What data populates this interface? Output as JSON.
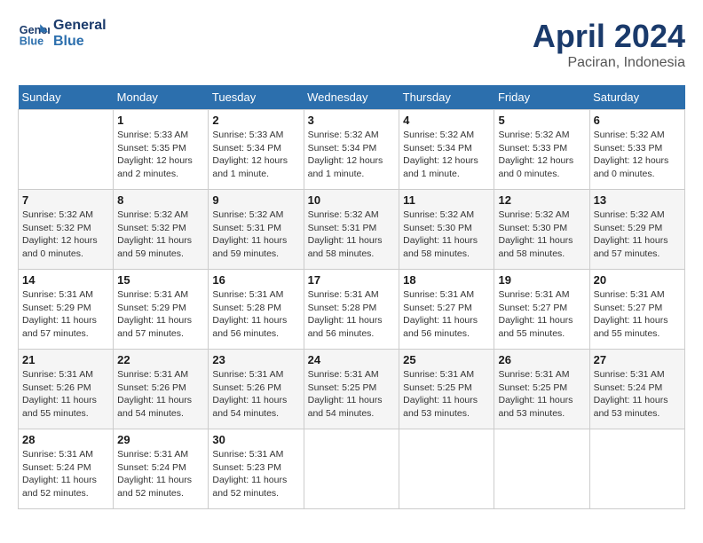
{
  "header": {
    "logo_line1": "General",
    "logo_line2": "Blue",
    "month": "April 2024",
    "location": "Paciran, Indonesia"
  },
  "columns": [
    "Sunday",
    "Monday",
    "Tuesday",
    "Wednesday",
    "Thursday",
    "Friday",
    "Saturday"
  ],
  "weeks": [
    [
      {
        "day": "",
        "sunrise": "",
        "sunset": "",
        "daylight": ""
      },
      {
        "day": "1",
        "sunrise": "Sunrise: 5:33 AM",
        "sunset": "Sunset: 5:35 PM",
        "daylight": "Daylight: 12 hours and 2 minutes."
      },
      {
        "day": "2",
        "sunrise": "Sunrise: 5:33 AM",
        "sunset": "Sunset: 5:34 PM",
        "daylight": "Daylight: 12 hours and 1 minute."
      },
      {
        "day": "3",
        "sunrise": "Sunrise: 5:32 AM",
        "sunset": "Sunset: 5:34 PM",
        "daylight": "Daylight: 12 hours and 1 minute."
      },
      {
        "day": "4",
        "sunrise": "Sunrise: 5:32 AM",
        "sunset": "Sunset: 5:34 PM",
        "daylight": "Daylight: 12 hours and 1 minute."
      },
      {
        "day": "5",
        "sunrise": "Sunrise: 5:32 AM",
        "sunset": "Sunset: 5:33 PM",
        "daylight": "Daylight: 12 hours and 0 minutes."
      },
      {
        "day": "6",
        "sunrise": "Sunrise: 5:32 AM",
        "sunset": "Sunset: 5:33 PM",
        "daylight": "Daylight: 12 hours and 0 minutes."
      }
    ],
    [
      {
        "day": "7",
        "sunrise": "Sunrise: 5:32 AM",
        "sunset": "Sunset: 5:32 PM",
        "daylight": "Daylight: 12 hours and 0 minutes."
      },
      {
        "day": "8",
        "sunrise": "Sunrise: 5:32 AM",
        "sunset": "Sunset: 5:32 PM",
        "daylight": "Daylight: 11 hours and 59 minutes."
      },
      {
        "day": "9",
        "sunrise": "Sunrise: 5:32 AM",
        "sunset": "Sunset: 5:31 PM",
        "daylight": "Daylight: 11 hours and 59 minutes."
      },
      {
        "day": "10",
        "sunrise": "Sunrise: 5:32 AM",
        "sunset": "Sunset: 5:31 PM",
        "daylight": "Daylight: 11 hours and 58 minutes."
      },
      {
        "day": "11",
        "sunrise": "Sunrise: 5:32 AM",
        "sunset": "Sunset: 5:30 PM",
        "daylight": "Daylight: 11 hours and 58 minutes."
      },
      {
        "day": "12",
        "sunrise": "Sunrise: 5:32 AM",
        "sunset": "Sunset: 5:30 PM",
        "daylight": "Daylight: 11 hours and 58 minutes."
      },
      {
        "day": "13",
        "sunrise": "Sunrise: 5:32 AM",
        "sunset": "Sunset: 5:29 PM",
        "daylight": "Daylight: 11 hours and 57 minutes."
      }
    ],
    [
      {
        "day": "14",
        "sunrise": "Sunrise: 5:31 AM",
        "sunset": "Sunset: 5:29 PM",
        "daylight": "Daylight: 11 hours and 57 minutes."
      },
      {
        "day": "15",
        "sunrise": "Sunrise: 5:31 AM",
        "sunset": "Sunset: 5:29 PM",
        "daylight": "Daylight: 11 hours and 57 minutes."
      },
      {
        "day": "16",
        "sunrise": "Sunrise: 5:31 AM",
        "sunset": "Sunset: 5:28 PM",
        "daylight": "Daylight: 11 hours and 56 minutes."
      },
      {
        "day": "17",
        "sunrise": "Sunrise: 5:31 AM",
        "sunset": "Sunset: 5:28 PM",
        "daylight": "Daylight: 11 hours and 56 minutes."
      },
      {
        "day": "18",
        "sunrise": "Sunrise: 5:31 AM",
        "sunset": "Sunset: 5:27 PM",
        "daylight": "Daylight: 11 hours and 56 minutes."
      },
      {
        "day": "19",
        "sunrise": "Sunrise: 5:31 AM",
        "sunset": "Sunset: 5:27 PM",
        "daylight": "Daylight: 11 hours and 55 minutes."
      },
      {
        "day": "20",
        "sunrise": "Sunrise: 5:31 AM",
        "sunset": "Sunset: 5:27 PM",
        "daylight": "Daylight: 11 hours and 55 minutes."
      }
    ],
    [
      {
        "day": "21",
        "sunrise": "Sunrise: 5:31 AM",
        "sunset": "Sunset: 5:26 PM",
        "daylight": "Daylight: 11 hours and 55 minutes."
      },
      {
        "day": "22",
        "sunrise": "Sunrise: 5:31 AM",
        "sunset": "Sunset: 5:26 PM",
        "daylight": "Daylight: 11 hours and 54 minutes."
      },
      {
        "day": "23",
        "sunrise": "Sunrise: 5:31 AM",
        "sunset": "Sunset: 5:26 PM",
        "daylight": "Daylight: 11 hours and 54 minutes."
      },
      {
        "day": "24",
        "sunrise": "Sunrise: 5:31 AM",
        "sunset": "Sunset: 5:25 PM",
        "daylight": "Daylight: 11 hours and 54 minutes."
      },
      {
        "day": "25",
        "sunrise": "Sunrise: 5:31 AM",
        "sunset": "Sunset: 5:25 PM",
        "daylight": "Daylight: 11 hours and 53 minutes."
      },
      {
        "day": "26",
        "sunrise": "Sunrise: 5:31 AM",
        "sunset": "Sunset: 5:25 PM",
        "daylight": "Daylight: 11 hours and 53 minutes."
      },
      {
        "day": "27",
        "sunrise": "Sunrise: 5:31 AM",
        "sunset": "Sunset: 5:24 PM",
        "daylight": "Daylight: 11 hours and 53 minutes."
      }
    ],
    [
      {
        "day": "28",
        "sunrise": "Sunrise: 5:31 AM",
        "sunset": "Sunset: 5:24 PM",
        "daylight": "Daylight: 11 hours and 52 minutes."
      },
      {
        "day": "29",
        "sunrise": "Sunrise: 5:31 AM",
        "sunset": "Sunset: 5:24 PM",
        "daylight": "Daylight: 11 hours and 52 minutes."
      },
      {
        "day": "30",
        "sunrise": "Sunrise: 5:31 AM",
        "sunset": "Sunset: 5:23 PM",
        "daylight": "Daylight: 11 hours and 52 minutes."
      },
      {
        "day": "",
        "sunrise": "",
        "sunset": "",
        "daylight": ""
      },
      {
        "day": "",
        "sunrise": "",
        "sunset": "",
        "daylight": ""
      },
      {
        "day": "",
        "sunrise": "",
        "sunset": "",
        "daylight": ""
      },
      {
        "day": "",
        "sunrise": "",
        "sunset": "",
        "daylight": ""
      }
    ]
  ]
}
